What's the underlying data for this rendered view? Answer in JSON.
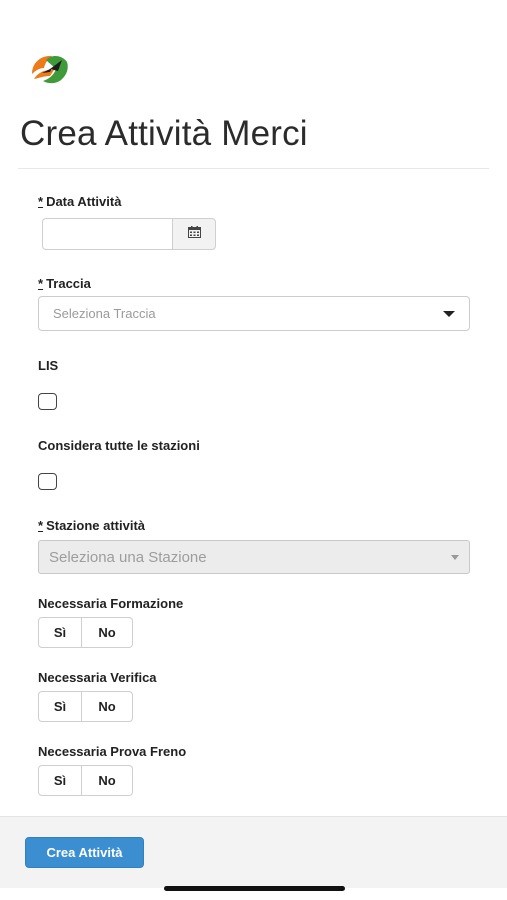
{
  "header": {
    "title": "Crea Attività Merci",
    "logo_icon": "train-logo-icon"
  },
  "form": {
    "required_mark": "*",
    "data_attivita": {
      "label": "Data Attività",
      "value": "",
      "calendar_icon": "calendar-icon"
    },
    "traccia": {
      "label": "Traccia",
      "placeholder": "Seleziona Traccia"
    },
    "lis": {
      "label": "LIS",
      "checked": false
    },
    "considera_stazioni": {
      "label": "Considera tutte le stazioni",
      "checked": false
    },
    "stazione_attivita": {
      "label": "Stazione attività",
      "placeholder": "Seleziona una Stazione"
    },
    "formazione": {
      "label": "Necessaria Formazione",
      "yes": "Sì",
      "no": "No"
    },
    "verifica": {
      "label": "Necessaria Verifica",
      "yes": "Sì",
      "no": "No"
    },
    "prova_freno": {
      "label": "Necessaria Prova Freno",
      "yes": "Sì",
      "no": "No"
    }
  },
  "footer": {
    "submit_label": "Crea Attività"
  },
  "colors": {
    "primary": "#3b8fd1",
    "logo_orange": "#ee7a1a",
    "logo_green": "#3f9b3a"
  }
}
